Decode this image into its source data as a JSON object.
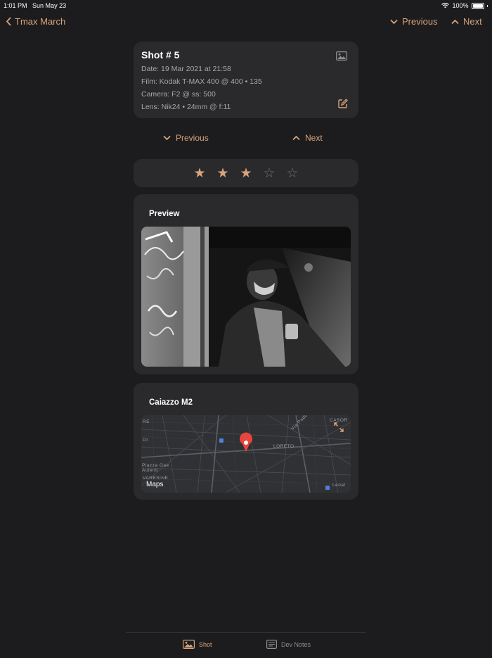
{
  "status_bar": {
    "time": "1:01 PM",
    "date": "Sun May 23",
    "battery": "100%"
  },
  "nav": {
    "back_label": "Tmax March",
    "previous_label": "Previous",
    "next_label": "Next"
  },
  "shot": {
    "title": "Shot # 5",
    "date_line": "Date:  19 Mar 2021  at  21:58",
    "film_line": "Film:  Kodak T-MAX 400  @  400  •  135",
    "camera_line": "Camera:  F2  @  ss: 500",
    "lens_line": "Lens:  Nik24  •  24mm  @  f:11"
  },
  "pager": {
    "previous_label": "Previous",
    "next_label": "Next"
  },
  "rating": {
    "value": 3,
    "max": 5
  },
  "preview": {
    "heading": "Preview"
  },
  "location": {
    "heading": "Caiazzo M2",
    "map_labels": {
      "casor": "CASOR",
      "loreto": "LORETO",
      "via_padova": "Via Padova",
      "piazza": "Piazza Gae Aulenti",
      "varesine": "VARESINE",
      "re": "RE",
      "di": "DI",
      "leoal": "Leoal"
    },
    "maps_brand": "Maps"
  },
  "tabs": [
    {
      "label": "Shot",
      "selected": true
    },
    {
      "label": "Dev Notes",
      "selected": false
    }
  ],
  "colors": {
    "accent": "#d8a37a",
    "background": "#1c1c1e",
    "card": "#2a2a2c",
    "pin": "#e8453c"
  }
}
